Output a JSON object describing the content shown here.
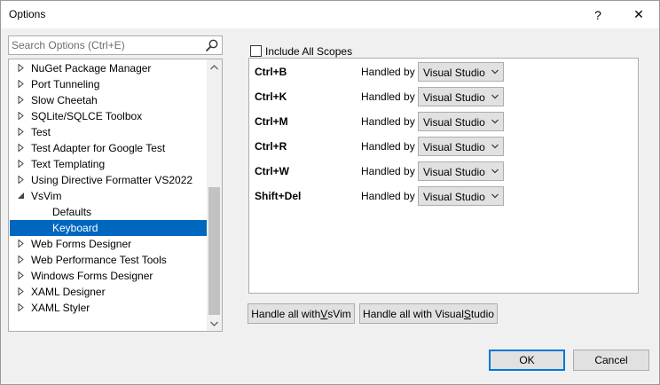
{
  "window": {
    "title": "Options",
    "help_glyph": "?",
    "close_glyph": "✕"
  },
  "search": {
    "placeholder": "Search Options (Ctrl+E)",
    "icon": "search-icon"
  },
  "tree": {
    "items": [
      {
        "label": "NuGet Package Manager",
        "level": 0,
        "expander": "collapsed"
      },
      {
        "label": "Port Tunneling",
        "level": 0,
        "expander": "collapsed"
      },
      {
        "label": "Slow Cheetah",
        "level": 0,
        "expander": "collapsed"
      },
      {
        "label": "SQLite/SQLCE Toolbox",
        "level": 0,
        "expander": "collapsed"
      },
      {
        "label": "Test",
        "level": 0,
        "expander": "collapsed"
      },
      {
        "label": "Test Adapter for Google Test",
        "level": 0,
        "expander": "collapsed"
      },
      {
        "label": "Text Templating",
        "level": 0,
        "expander": "collapsed"
      },
      {
        "label": "Using Directive Formatter VS2022",
        "level": 0,
        "expander": "collapsed"
      },
      {
        "label": "VsVim",
        "level": 0,
        "expander": "expanded"
      },
      {
        "label": "Defaults",
        "level": 1,
        "expander": "none"
      },
      {
        "label": "Keyboard",
        "level": 1,
        "expander": "none",
        "selected": true
      },
      {
        "label": "Web Forms Designer",
        "level": 0,
        "expander": "collapsed"
      },
      {
        "label": "Web Performance Test Tools",
        "level": 0,
        "expander": "collapsed"
      },
      {
        "label": "Windows Forms Designer",
        "level": 0,
        "expander": "collapsed"
      },
      {
        "label": "XAML Designer",
        "level": 0,
        "expander": "collapsed"
      },
      {
        "label": "XAML Styler",
        "level": 0,
        "expander": "collapsed"
      }
    ]
  },
  "scopes": {
    "label": "Include All Scopes",
    "checked": false
  },
  "keys": {
    "handled_by_label": "Handled by",
    "rows": [
      {
        "key": "Ctrl+B",
        "handler": "Visual Studio"
      },
      {
        "key": "Ctrl+K",
        "handler": "Visual Studio"
      },
      {
        "key": "Ctrl+M",
        "handler": "Visual Studio"
      },
      {
        "key": "Ctrl+R",
        "handler": "Visual Studio"
      },
      {
        "key": "Ctrl+W",
        "handler": "Visual Studio"
      },
      {
        "key": "Shift+Del",
        "handler": "Visual Studio"
      }
    ]
  },
  "buttons": {
    "handle_vsvim_prefix": "Handle all with ",
    "handle_vsvim_access": "V",
    "handle_vsvim_suffix": "sVim",
    "handle_vs_prefix": "Handle all with Visual ",
    "handle_vs_access": "S",
    "handle_vs_suffix": "tudio",
    "ok": "OK",
    "cancel": "Cancel"
  },
  "colors": {
    "selection": "#0067c0",
    "default_button_border": "#0078d7",
    "dialog_background": "#f0f0f0"
  }
}
